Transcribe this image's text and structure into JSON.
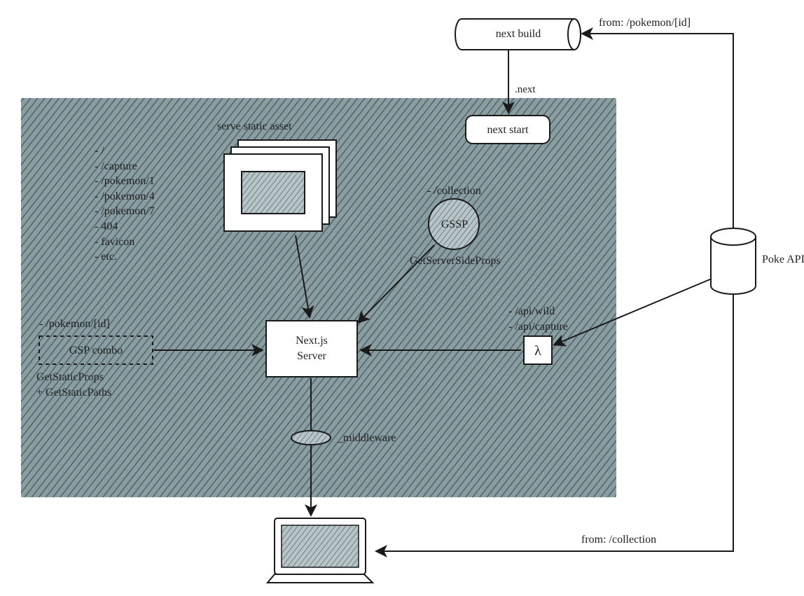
{
  "box": {
    "static_title": "serve static asset",
    "routes_list": "- /\n- /capture\n- /pokemon/1\n- /pokemon/4\n- /pokemon/7\n- 404\n- favicon\n- etc.",
    "gssp_route": "- /collection",
    "gssp_circle": "GSSP",
    "gssp_full": "GetServerSideProps",
    "gsp_route": "- /pokemon/[id]",
    "gsp_combo": "GSP combo",
    "gsp_full": "GetStaticProps\n+ GetStaticPaths",
    "server": "Next.js\nServer",
    "api_routes": "- /api/wild\n- /api/capture",
    "lambda": "λ",
    "middleware": "_middleware"
  },
  "outside": {
    "next_build": "next build",
    "dot_next": ".next",
    "next_start": "next start",
    "poke_api": "Poke API",
    "from_pokemon": "from: /pokemon/[id]",
    "from_collection": "from: /collection"
  },
  "colors": {
    "hatch": "#54696d",
    "stroke": "#1a1a1a"
  }
}
